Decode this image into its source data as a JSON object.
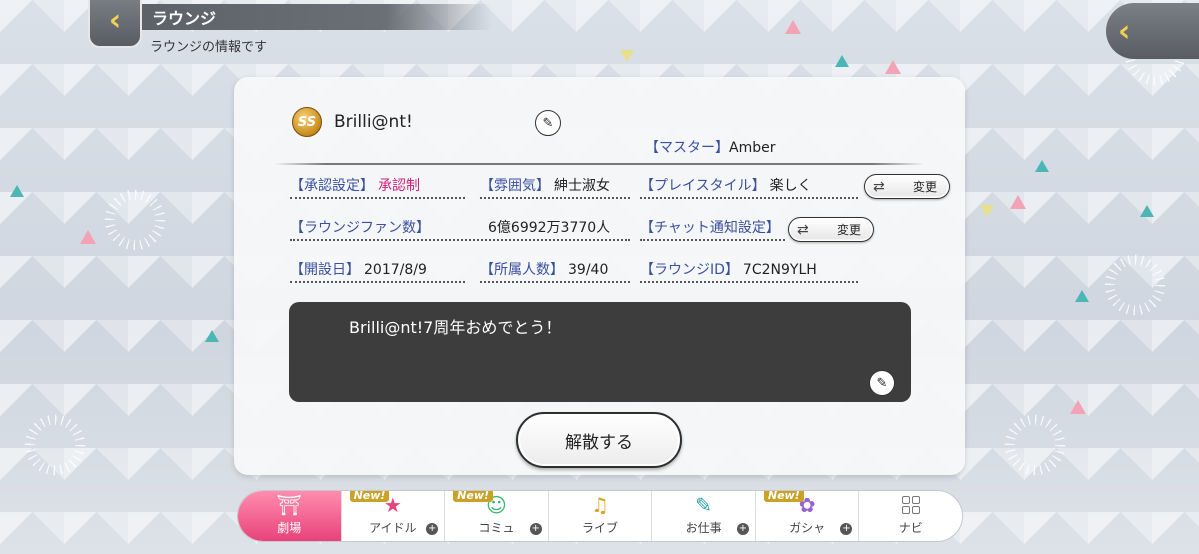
{
  "header": {
    "title": "ラウンジ",
    "subtitle": "ラウンジの情報です"
  },
  "lounge": {
    "rank_badge": "SS",
    "name": "Brilli@nt!",
    "master_label": "【マスター】",
    "master_value": "Amber"
  },
  "fields": {
    "approval_label": "【承認設定】",
    "approval_value": "承認制",
    "atmosphere_label": "【雰囲気】",
    "atmosphere_value": "紳士淑女",
    "playstyle_label": "【プレイスタイル】",
    "playstyle_value": "楽しく",
    "fans_label": "【ラウンジファン数】",
    "fans_value": "6億6992万3770人",
    "chat_label": "【チャット通知設定】",
    "founded_label": "【開設日】",
    "founded_value": "2017/8/9",
    "members_label": "【所属人数】",
    "members_value": "39/40",
    "lounge_id_label": "【ラウンジID】",
    "lounge_id_value": "7C2N9YLH"
  },
  "buttons": {
    "change_label": "変更",
    "disband_label": "解散する"
  },
  "comment": "Brilli@nt!7周年おめでとう！",
  "nav": {
    "items": [
      {
        "label": "劇場",
        "new": ""
      },
      {
        "label": "アイドル",
        "new": "New!"
      },
      {
        "label": "コミュ",
        "new": "New!"
      },
      {
        "label": "ライブ",
        "new": ""
      },
      {
        "label": "お仕事",
        "new": ""
      },
      {
        "label": "ガシャ",
        "new": "New!"
      },
      {
        "label": "ナビ",
        "new": ""
      }
    ]
  },
  "colors": {
    "label_blue": "#3a50a0",
    "approval_pink": "#d0227a",
    "nav_active": "#e8427a"
  }
}
